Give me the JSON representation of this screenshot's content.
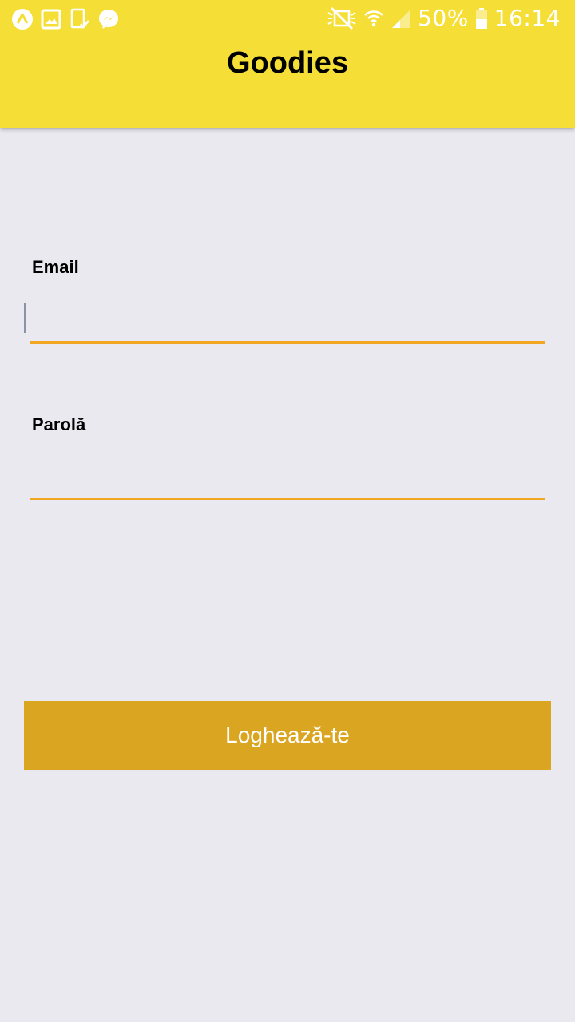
{
  "status_bar": {
    "left_icons": [
      "app-notification-icon",
      "image-icon",
      "device-check-icon",
      "messenger-icon"
    ],
    "right_icons": [
      "mute-icon",
      "wifi-icon",
      "signal-icon",
      "battery-icon"
    ],
    "battery": "50%",
    "time": "16:14"
  },
  "header": {
    "title": "Goodies",
    "background": "#f5df36"
  },
  "form": {
    "email_label": "Email",
    "email_value": "",
    "password_label": "Parolă",
    "password_value": "",
    "underline_color": "#f2a723"
  },
  "login_button": {
    "label": "Loghează-te",
    "color": "#daa520"
  }
}
